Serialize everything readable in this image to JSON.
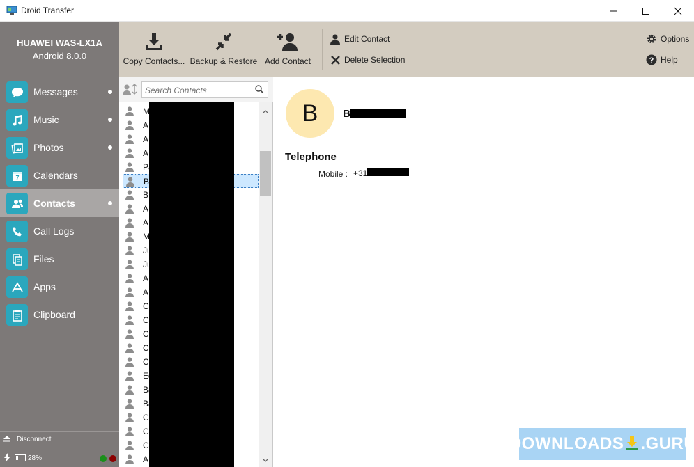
{
  "window": {
    "title": "Droid Transfer",
    "controls": {
      "minimize": "—",
      "maximize": "☐",
      "close": "✕"
    }
  },
  "device": {
    "name": "HUAWEI WAS-LX1A",
    "os": "Android 8.0.0",
    "battery_level": 0.28,
    "battery_text": "28%"
  },
  "sidebar": {
    "items": [
      {
        "label": "Messages",
        "icon": "speech-bubble-icon",
        "dot": true
      },
      {
        "label": "Music",
        "icon": "music-note-icon",
        "dot": true
      },
      {
        "label": "Photos",
        "icon": "photos-icon",
        "dot": true
      },
      {
        "label": "Calendars",
        "icon": "calendar-icon",
        "dot": false
      },
      {
        "label": "Contacts",
        "icon": "contacts-icon",
        "dot": true,
        "active": true
      },
      {
        "label": "Call Logs",
        "icon": "phone-icon",
        "dot": false
      },
      {
        "label": "Files",
        "icon": "files-icon",
        "dot": false
      },
      {
        "label": "Apps",
        "icon": "apps-icon",
        "dot": false
      },
      {
        "label": "Clipboard",
        "icon": "clipboard-icon",
        "dot": false
      }
    ],
    "disconnect_label": "Disconnect",
    "status_colors": {
      "connected": "#1a8f1a",
      "error": "#8b0000"
    }
  },
  "toolbar": {
    "copy_contacts": "Copy Contacts...",
    "backup_restore": "Backup & Restore",
    "add_contact": "Add Contact",
    "edit_contact": "Edit Contact",
    "delete_selection": "Delete Selection",
    "options": "Options",
    "help": "Help"
  },
  "search": {
    "placeholder": "Search Contacts"
  },
  "contacts": [
    "M",
    "A",
    "A",
    "A",
    "Pa",
    "B",
    "B",
    "A",
    "A",
    "M",
    "Ju",
    "Ju",
    "A",
    "A",
    "C",
    "C",
    "C",
    "C",
    "C",
    "Ed",
    "Ba",
    "Ba",
    "C",
    "C",
    "C",
    "A"
  ],
  "selected_index": 5,
  "detail": {
    "avatar_letter": "B",
    "name": "B",
    "section_title": "Telephone",
    "phone_label": "Mobile :",
    "phone_value": "+31"
  },
  "watermark": {
    "text": "DOWNLOADS",
    "suffix": ".GURU"
  },
  "colors": {
    "sidebar": "#7d7978",
    "sidebar_active": "#a9a6a5",
    "icon_tile": "#2ba7bd",
    "toolbar": "#d3ccc0",
    "avatar": "#fde8b0"
  }
}
